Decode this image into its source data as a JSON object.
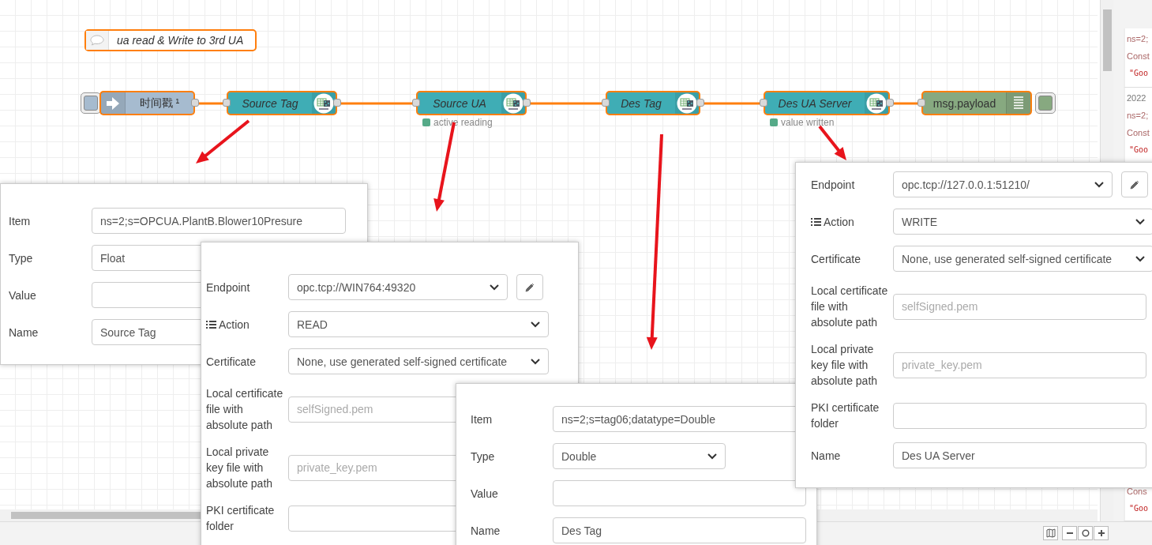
{
  "comment": "ua read & Write to 3rd UA",
  "nodes": [
    {
      "kind": "inject",
      "label": "时间戳 ¹"
    },
    {
      "kind": "opcua",
      "label": "Source Tag"
    },
    {
      "kind": "opcua",
      "label": "Source UA",
      "status": "active reading"
    },
    {
      "kind": "opcua",
      "label": "Des Tag"
    },
    {
      "kind": "opcua",
      "label": "Des UA Server",
      "status": "value written"
    },
    {
      "kind": "debug",
      "label": "msg.payload"
    }
  ],
  "panels": [
    {
      "fields": [
        {
          "kind": "text",
          "label": "Item",
          "value": "ns=2;s=OPCUA.PlantB.Blower10Presure"
        },
        {
          "kind": "select",
          "label": "Type",
          "value": "Float"
        },
        {
          "kind": "text",
          "label": "Value"
        },
        {
          "kind": "text",
          "label": "Name",
          "value": "Source Tag"
        }
      ]
    },
    {
      "fields": [
        {
          "kind": "endpoint",
          "label": "Endpoint",
          "value": "opc.tcp://WIN764:49320"
        },
        {
          "kind": "action",
          "label": "Action",
          "value": "READ"
        },
        {
          "kind": "select",
          "label": "Certificate",
          "value": "None, use generated self-signed certificate"
        },
        {
          "kind": "text",
          "label": "Local certificate file with absolute path",
          "placeholder": "selfSigned.pem"
        },
        {
          "kind": "text",
          "label": "Local private key file with absolute path",
          "placeholder": "private_key.pem"
        },
        {
          "kind": "text",
          "label": "PKI certificate folder"
        }
      ]
    },
    {
      "fields": [
        {
          "kind": "text",
          "label": "Item",
          "value": "ns=2;s=tag06;datatype=Double"
        },
        {
          "kind": "select",
          "label": "Type",
          "value": "Double"
        },
        {
          "kind": "text",
          "label": "Value"
        },
        {
          "kind": "text",
          "label": "Name",
          "value": "Des Tag"
        }
      ]
    },
    {
      "fields": [
        {
          "kind": "endpoint",
          "label": "Endpoint",
          "value": "opc.tcp://127.0.0.1:51210/"
        },
        {
          "kind": "action",
          "label": "Action",
          "value": "WRITE"
        },
        {
          "kind": "select",
          "label": "Certificate",
          "value": "None, use generated self-signed certificate"
        },
        {
          "kind": "text",
          "label": "Local certificate file with absolute path",
          "placeholder": "selfSigned.pem"
        },
        {
          "kind": "text",
          "label": "Local private key file with absolute path",
          "placeholder": "private_key.pem"
        },
        {
          "kind": "text",
          "label": "PKI certificate folder"
        },
        {
          "kind": "text",
          "label": "Name",
          "value": "Des UA Server"
        }
      ]
    }
  ],
  "debug_messages": [
    {
      "topic": "ns=2;",
      "type": "Const",
      "value": "\"Goo"
    },
    {
      "date": "2022",
      "topic": "ns=2;",
      "type": "Const",
      "value": "\"Goo"
    },
    {
      "type": "Cons",
      "value": "\"Goo"
    }
  ]
}
